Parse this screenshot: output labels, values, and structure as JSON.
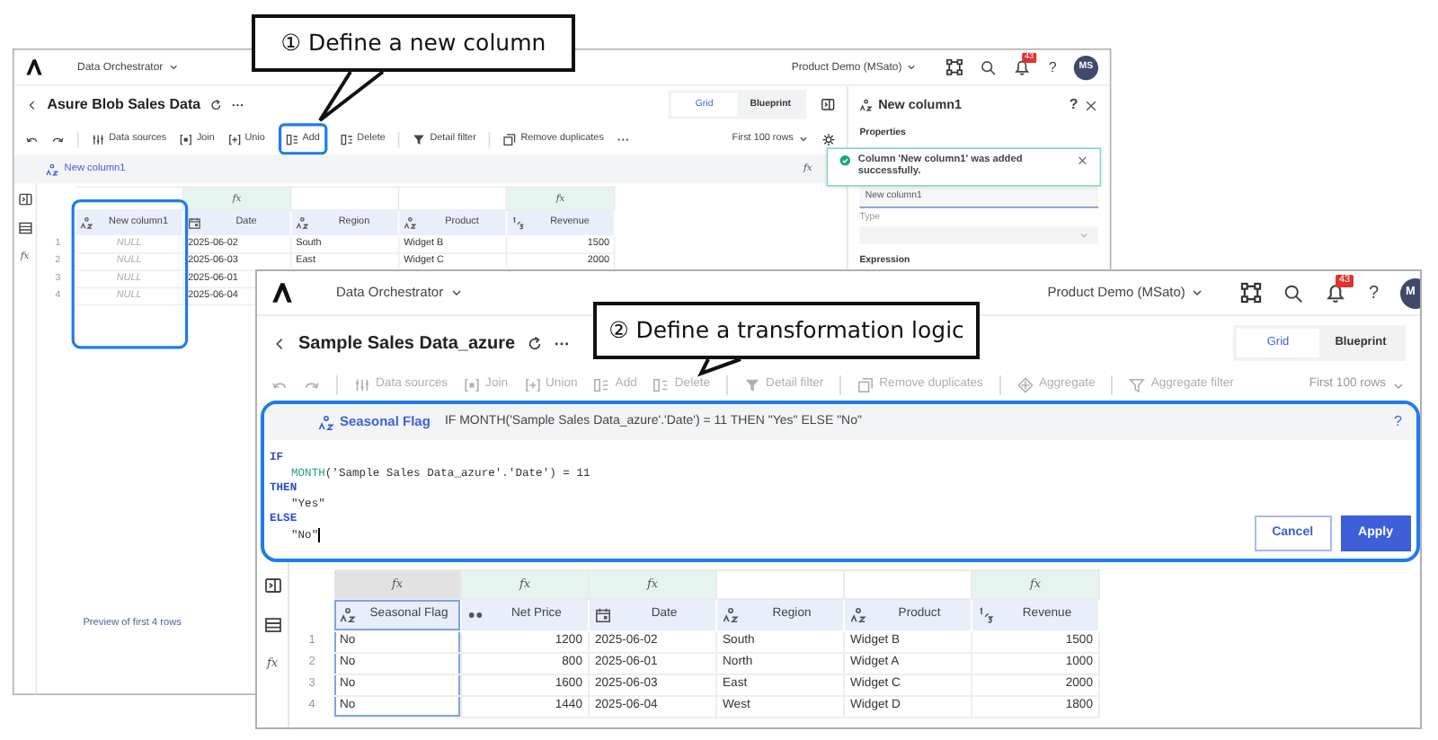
{
  "callouts": [
    {
      "text": "① Define a new column"
    },
    {
      "text": "② Define a transformation logic"
    }
  ],
  "back_window": {
    "app_name": "Data Orchestrator",
    "workspace": "Product Demo (MSato)",
    "notifications": "43",
    "help": "?",
    "avatar": "MS",
    "title": "Asure Blob Sales Data",
    "view_tabs": [
      {
        "label": "Grid",
        "selected": true
      },
      {
        "label": "Blueprint",
        "selected": false
      }
    ],
    "toolbar": {
      "disabled": false,
      "more_menu": true,
      "settings": true,
      "row_limit": "First 100 rows",
      "items": [
        {
          "kind": "data_sources",
          "label": "Data sources",
          "highlighted": false
        },
        {
          "kind": "join",
          "label": "Join",
          "highlighted": false
        },
        {
          "kind": "union",
          "label": "Unio",
          "highlighted": false
        },
        {
          "kind": "add",
          "label": "Add",
          "highlighted": true
        },
        {
          "kind": "delete",
          "label": "Delete",
          "highlighted": false
        },
        {
          "kind": "filter",
          "label": "Detail filter",
          "highlighted": false
        },
        {
          "kind": "dedupe",
          "label": "Remove duplicates",
          "highlighted": false
        }
      ]
    },
    "formula_bar": {
      "column": "New column1",
      "fx": "fx"
    },
    "side_fx": "fx",
    "columns": [
      {
        "name": "New column1",
        "kind": "text",
        "highlighted": true,
        "selected": false,
        "values_null": true
      },
      {
        "name": "Date",
        "kind": "date",
        "formula": "fx",
        "highlighted": false,
        "selected": false,
        "values_null": false
      },
      {
        "name": "Region",
        "kind": "text",
        "highlighted": false,
        "selected": false,
        "values_null": false
      },
      {
        "name": "Product",
        "kind": "text",
        "highlighted": false,
        "selected": false,
        "values_null": false
      },
      {
        "name": "Revenue",
        "kind": "integer",
        "formula": "fx",
        "highlighted": false,
        "selected": false,
        "values_null": false
      }
    ],
    "rows": [
      {
        "number": "1",
        "cells": [
          "NULL",
          "2025-06-02",
          "South",
          "Widget B",
          "1500"
        ]
      },
      {
        "number": "2",
        "cells": [
          "NULL",
          "2025-06-03",
          "East",
          "Widget C",
          "2000"
        ]
      },
      {
        "number": "3",
        "cells": [
          "NULL",
          "2025-06-01"
        ]
      },
      {
        "number": "4",
        "cells": [
          "NULL",
          "2025-06-04"
        ]
      }
    ],
    "footer": "Preview of first 4 rows",
    "panel": {
      "title": "New column1",
      "help": "?",
      "section": "Properties",
      "name_value": "New column1",
      "type_label": "Type",
      "expression_label": "Expression"
    },
    "toast": {
      "message": "Column 'New column1' was added successfully."
    }
  },
  "front_window": {
    "app_name": "Data Orchestrator",
    "workspace": "Product Demo (MSato)",
    "notifications": "43",
    "help": "?",
    "avatar": "M",
    "title": "Sample Sales Data_azure",
    "view_tabs": [
      {
        "label": "Grid",
        "selected": true
      },
      {
        "label": "Blueprint",
        "selected": false
      }
    ],
    "toolbar": {
      "disabled": true,
      "more_menu": false,
      "settings": false,
      "row_limit": "First 100 rows",
      "items": [
        {
          "kind": "data_sources",
          "label": "Data sources",
          "highlighted": false
        },
        {
          "kind": "join",
          "label": "Join",
          "highlighted": false
        },
        {
          "kind": "union",
          "label": "Union",
          "highlighted": false
        },
        {
          "kind": "add",
          "label": "Add",
          "highlighted": false
        },
        {
          "kind": "delete",
          "label": "Delete",
          "highlighted": false
        },
        {
          "kind": "filter",
          "label": "Detail filter",
          "highlighted": false
        },
        {
          "kind": "dedupe",
          "label": "Remove duplicates",
          "highlighted": false
        },
        {
          "kind": "aggregate",
          "label": "Aggregate",
          "highlighted": false
        },
        {
          "kind": "aggregate_filter",
          "label": "Aggregate filter",
          "highlighted": false
        }
      ]
    },
    "editor": {
      "highlighted": true,
      "column": "Seasonal Flag",
      "expression": "IF MONTH('Sample Sales Data_azure'.'Date') = 11 THEN \"Yes\" ELSE \"No\"",
      "help": "?",
      "cursor": true,
      "lines": [
        [
          {
            "kind": "keyword",
            "text": "IF"
          }
        ],
        [
          {
            "kind": "function",
            "text": "MONTH"
          },
          {
            "kind": "plain",
            "text": "('Sample Sales Data_azure'.'Date') = 11"
          }
        ],
        [
          {
            "kind": "keyword",
            "text": "THEN"
          }
        ],
        [
          {
            "kind": "plain",
            "text": "\"Yes\""
          }
        ],
        [
          {
            "kind": "keyword",
            "text": "ELSE"
          }
        ],
        [
          {
            "kind": "plain",
            "text": "\"No\""
          }
        ]
      ],
      "buttons": [
        {
          "kind": "secondary",
          "label": "Cancel"
        },
        {
          "kind": "primary",
          "label": "Apply"
        }
      ]
    },
    "side_fx": "fx",
    "columns": [
      {
        "name": "Seasonal Flag",
        "kind": "text",
        "formula": "fx",
        "highlighted": false,
        "selected": true,
        "values_null": false
      },
      {
        "name": "Net Price",
        "kind": "decimal",
        "formula": "fx",
        "highlighted": false,
        "selected": false,
        "values_null": false
      },
      {
        "name": "Date",
        "kind": "date",
        "formula": "fx",
        "highlighted": false,
        "selected": false,
        "values_null": false
      },
      {
        "name": "Region",
        "kind": "text",
        "highlighted": false,
        "selected": false,
        "values_null": false
      },
      {
        "name": "Product",
        "kind": "text",
        "highlighted": false,
        "selected": false,
        "values_null": false
      },
      {
        "name": "Revenue",
        "kind": "integer",
        "formula": "fx",
        "highlighted": false,
        "selected": false,
        "values_null": false
      }
    ],
    "rows": [
      {
        "number": "1",
        "cells": [
          "No",
          "1200",
          "2025-06-02",
          "South",
          "Widget B",
          "1500"
        ]
      },
      {
        "number": "2",
        "cells": [
          "No",
          "800",
          "2025-06-01",
          "North",
          "Widget A",
          "1000"
        ]
      },
      {
        "number": "3",
        "cells": [
          "No",
          "1600",
          "2025-06-03",
          "East",
          "Widget C",
          "2000"
        ]
      },
      {
        "number": "4",
        "cells": [
          "No",
          "1440",
          "2025-06-04",
          "West",
          "Widget D",
          "1800"
        ]
      }
    ]
  }
}
